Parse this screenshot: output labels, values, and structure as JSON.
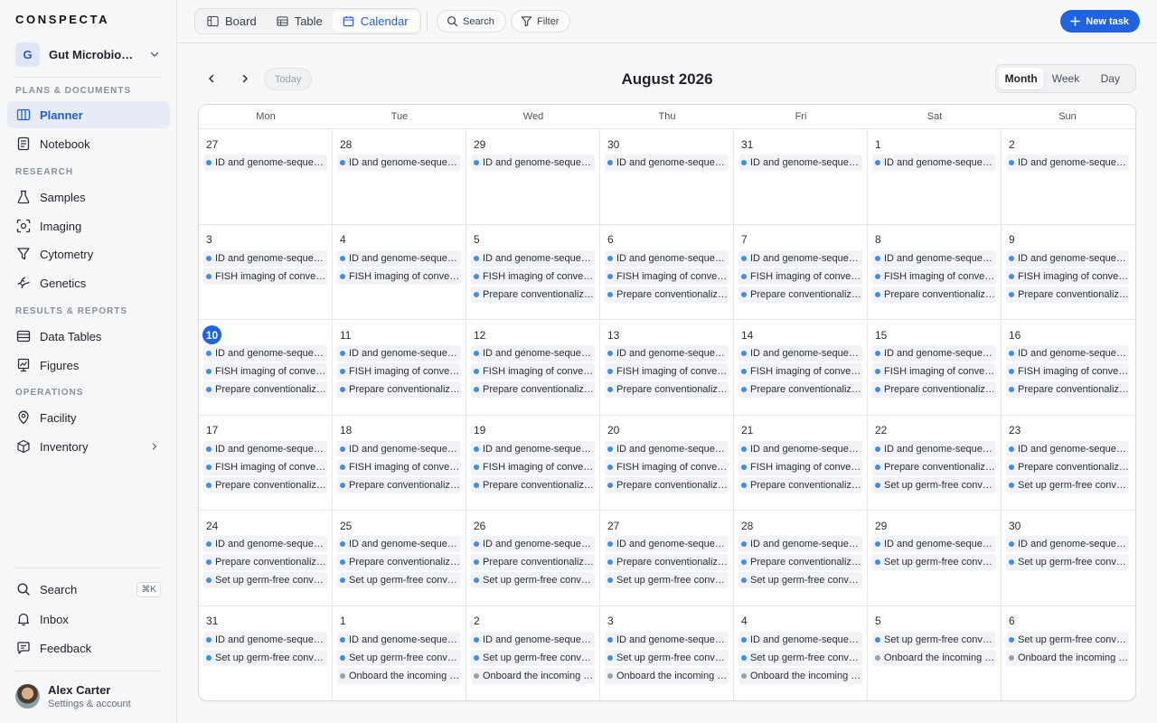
{
  "brand": "CONSPECTA",
  "project": {
    "initial": "G",
    "name": "Gut Microbiome Study"
  },
  "sidebar": {
    "sections": [
      {
        "label": "PLANS & DOCUMENTS",
        "items": [
          {
            "label": "Planner",
            "icon": "columns-icon",
            "active": true
          },
          {
            "label": "Notebook",
            "icon": "notebook-icon"
          }
        ]
      },
      {
        "label": "RESEARCH",
        "items": [
          {
            "label": "Samples",
            "icon": "flask-icon"
          },
          {
            "label": "Imaging",
            "icon": "imaging-icon"
          },
          {
            "label": "Cytometry",
            "icon": "funnel-icon"
          },
          {
            "label": "Genetics",
            "icon": "dna-icon"
          }
        ]
      },
      {
        "label": "RESULTS & REPORTS",
        "items": [
          {
            "label": "Data Tables",
            "icon": "table-icon"
          },
          {
            "label": "Figures",
            "icon": "figure-icon"
          }
        ]
      },
      {
        "label": "OPERATIONS",
        "items": [
          {
            "label": "Facility",
            "icon": "location-pin-icon"
          },
          {
            "label": "Inventory",
            "icon": "box-icon"
          }
        ]
      }
    ],
    "bottom": [
      {
        "label": "Search",
        "icon": "search-icon",
        "shortcut": "⌘K"
      },
      {
        "label": "Inbox",
        "icon": "bell-icon"
      },
      {
        "label": "Feedback",
        "icon": "message-icon"
      }
    ],
    "user": {
      "name": "Alex Carter",
      "subtitle": "Settings & account"
    }
  },
  "toolbar": {
    "views": [
      {
        "label": "Board",
        "icon": "board-icon"
      },
      {
        "label": "Table",
        "icon": "table-icon"
      },
      {
        "label": "Calendar",
        "icon": "calendar-icon",
        "active": true
      }
    ],
    "search_label": "Search",
    "filter_label": "Filter",
    "new_task_label": "New task"
  },
  "calendar": {
    "title": "August 2026",
    "today_label": "Today",
    "modes": [
      "Month",
      "Week",
      "Day"
    ],
    "active_mode": "Month",
    "today_date": 10,
    "weekdays": [
      "Mon",
      "Tue",
      "Wed",
      "Thu",
      "Fri",
      "Sat",
      "Sun"
    ],
    "event_types": {
      "id": {
        "label": "ID and genome-sequencing of isolates",
        "color": "#3b8fe8"
      },
      "fish": {
        "label": "FISH imaging of conventional mice",
        "color": "#3b8fe8"
      },
      "prep": {
        "label": "Prepare conventionalized cohort",
        "color": "#3b8fe8"
      },
      "germ": {
        "label": "Set up germ-free conventionalization",
        "color": "#3b8fe8"
      },
      "onboard": {
        "label": "Onboard the incoming rotation student",
        "color": "#9aa0a8"
      }
    },
    "weeks": [
      [
        {
          "d": "27",
          "e": [
            "id"
          ]
        },
        {
          "d": "28",
          "e": [
            "id"
          ]
        },
        {
          "d": "29",
          "e": [
            "id"
          ]
        },
        {
          "d": "30",
          "e": [
            "id"
          ]
        },
        {
          "d": "31",
          "e": [
            "id"
          ]
        },
        {
          "d": "1",
          "e": [
            "id"
          ]
        },
        {
          "d": "2",
          "e": [
            "id"
          ]
        }
      ],
      [
        {
          "d": "3",
          "e": [
            "id",
            "fish"
          ]
        },
        {
          "d": "4",
          "e": [
            "id",
            "fish"
          ]
        },
        {
          "d": "5",
          "e": [
            "id",
            "fish",
            "prep"
          ]
        },
        {
          "d": "6",
          "e": [
            "id",
            "fish",
            "prep"
          ]
        },
        {
          "d": "7",
          "e": [
            "id",
            "fish",
            "prep"
          ]
        },
        {
          "d": "8",
          "e": [
            "id",
            "fish",
            "prep"
          ]
        },
        {
          "d": "9",
          "e": [
            "id",
            "fish",
            "prep"
          ]
        }
      ],
      [
        {
          "d": "10",
          "e": [
            "id",
            "fish",
            "prep"
          ]
        },
        {
          "d": "11",
          "e": [
            "id",
            "fish",
            "prep"
          ]
        },
        {
          "d": "12",
          "e": [
            "id",
            "fish",
            "prep"
          ]
        },
        {
          "d": "13",
          "e": [
            "id",
            "fish",
            "prep"
          ]
        },
        {
          "d": "14",
          "e": [
            "id",
            "fish",
            "prep"
          ]
        },
        {
          "d": "15",
          "e": [
            "id",
            "fish",
            "prep"
          ]
        },
        {
          "d": "16",
          "e": [
            "id",
            "fish",
            "prep"
          ]
        }
      ],
      [
        {
          "d": "17",
          "e": [
            "id",
            "fish",
            "prep"
          ]
        },
        {
          "d": "18",
          "e": [
            "id",
            "fish",
            "prep"
          ]
        },
        {
          "d": "19",
          "e": [
            "id",
            "fish",
            "prep"
          ]
        },
        {
          "d": "20",
          "e": [
            "id",
            "fish",
            "prep"
          ]
        },
        {
          "d": "21",
          "e": [
            "id",
            "fish",
            "prep"
          ]
        },
        {
          "d": "22",
          "e": [
            "id",
            "prep",
            "germ"
          ]
        },
        {
          "d": "23",
          "e": [
            "id",
            "prep",
            "germ"
          ]
        }
      ],
      [
        {
          "d": "24",
          "e": [
            "id",
            "prep",
            "germ"
          ]
        },
        {
          "d": "25",
          "e": [
            "id",
            "prep",
            "germ"
          ]
        },
        {
          "d": "26",
          "e": [
            "id",
            "prep",
            "germ"
          ]
        },
        {
          "d": "27",
          "e": [
            "id",
            "prep",
            "germ"
          ]
        },
        {
          "d": "28",
          "e": [
            "id",
            "prep",
            "germ"
          ]
        },
        {
          "d": "29",
          "e": [
            "id",
            "germ"
          ]
        },
        {
          "d": "30",
          "e": [
            "id",
            "germ"
          ]
        }
      ],
      [
        {
          "d": "31",
          "e": [
            "id",
            "germ"
          ]
        },
        {
          "d": "1",
          "e": [
            "id",
            "germ",
            "onboard"
          ]
        },
        {
          "d": "2",
          "e": [
            "id",
            "germ",
            "onboard"
          ]
        },
        {
          "d": "3",
          "e": [
            "id",
            "germ",
            "onboard"
          ]
        },
        {
          "d": "4",
          "e": [
            "id",
            "germ",
            "onboard"
          ]
        },
        {
          "d": "5",
          "e": [
            "germ",
            "onboard"
          ]
        },
        {
          "d": "6",
          "e": [
            "germ",
            "onboard"
          ]
        }
      ]
    ]
  }
}
